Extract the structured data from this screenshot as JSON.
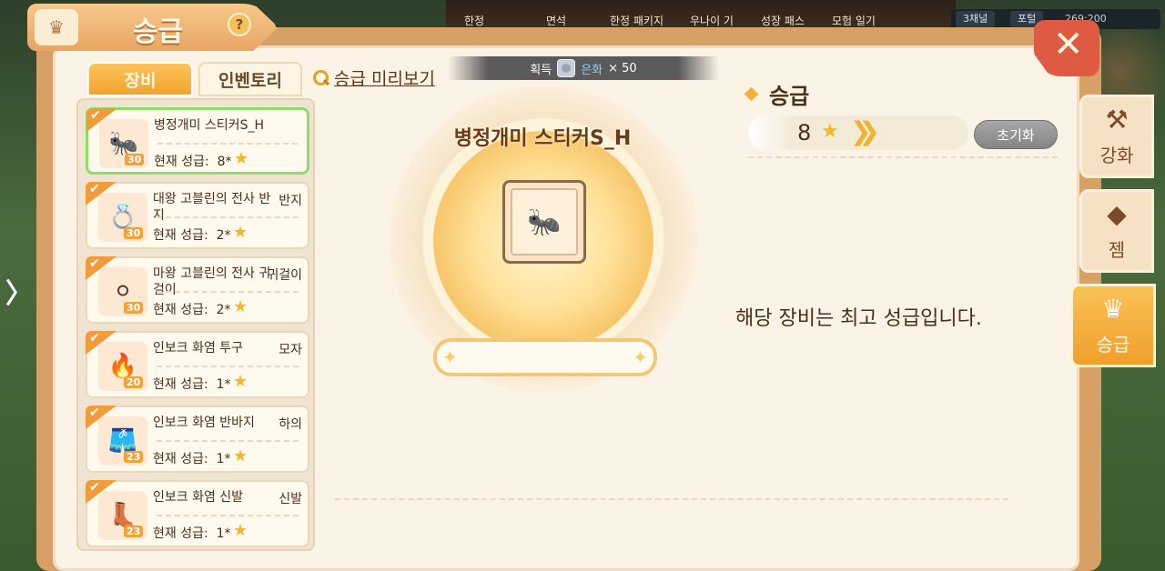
{
  "background": {
    "top_labels": [
      "한정",
      "면석",
      "한정 패키지",
      "우나이 기",
      "성장 패스",
      "모험 일기"
    ],
    "channel": "3채널",
    "portal": "포털",
    "coords": "269:200"
  },
  "header": {
    "title": "승급",
    "help": "?",
    "close": "✕"
  },
  "tabs": {
    "equipment": "장비",
    "inventory": "인벤토리"
  },
  "preview_link": "승급 미리보기",
  "reward": {
    "prefix": "획득",
    "currency": "은화",
    "amount": "× 50"
  },
  "items": [
    {
      "name": "병정개미 스티커S_H",
      "type": "",
      "grade_label": "현재 성급:",
      "grade": "8*",
      "level": "30",
      "icon": "🐜",
      "selected": true
    },
    {
      "name": "대왕 고블린의 전사 반지",
      "type": "반지",
      "grade_label": "현재 성급:",
      "grade": "2*",
      "level": "30",
      "icon": "💍",
      "selected": false
    },
    {
      "name": "마왕 고블린의 전사 귀걸이",
      "type": "귀걸이",
      "grade_label": "현재 성급:",
      "grade": "2*",
      "level": "30",
      "icon": "⚪",
      "selected": false
    },
    {
      "name": "인보크 화염 투구",
      "type": "모자",
      "grade_label": "현재 성급:",
      "grade": "1*",
      "level": "20",
      "icon": "🔥",
      "selected": false
    },
    {
      "name": "인보크 화염 반바지",
      "type": "하의",
      "grade_label": "현재 성급:",
      "grade": "1*",
      "level": "23",
      "icon": "🩳",
      "selected": false
    },
    {
      "name": "인보크 화염 신발",
      "type": "신발",
      "grade_label": "현재 성급:",
      "grade": "1*",
      "level": "23",
      "icon": "👢",
      "selected": false
    }
  ],
  "selected_item": {
    "name": "병정개미 스티커S_H",
    "icon": "🐜"
  },
  "grade_info": {
    "title": "승급",
    "current": "8",
    "reset_label": "초기화",
    "message": "해당 장비는 최고 성급입니다."
  },
  "side_tabs": [
    {
      "label": "강화",
      "icon": "⚒"
    },
    {
      "label": "젬",
      "icon": "◆"
    },
    {
      "label": "승급",
      "icon": "♛"
    }
  ],
  "colors": {
    "panel": "#d7a166",
    "accent": "#f2a42e",
    "selected_border": "#8fdc6a",
    "close": "#df5a42"
  }
}
